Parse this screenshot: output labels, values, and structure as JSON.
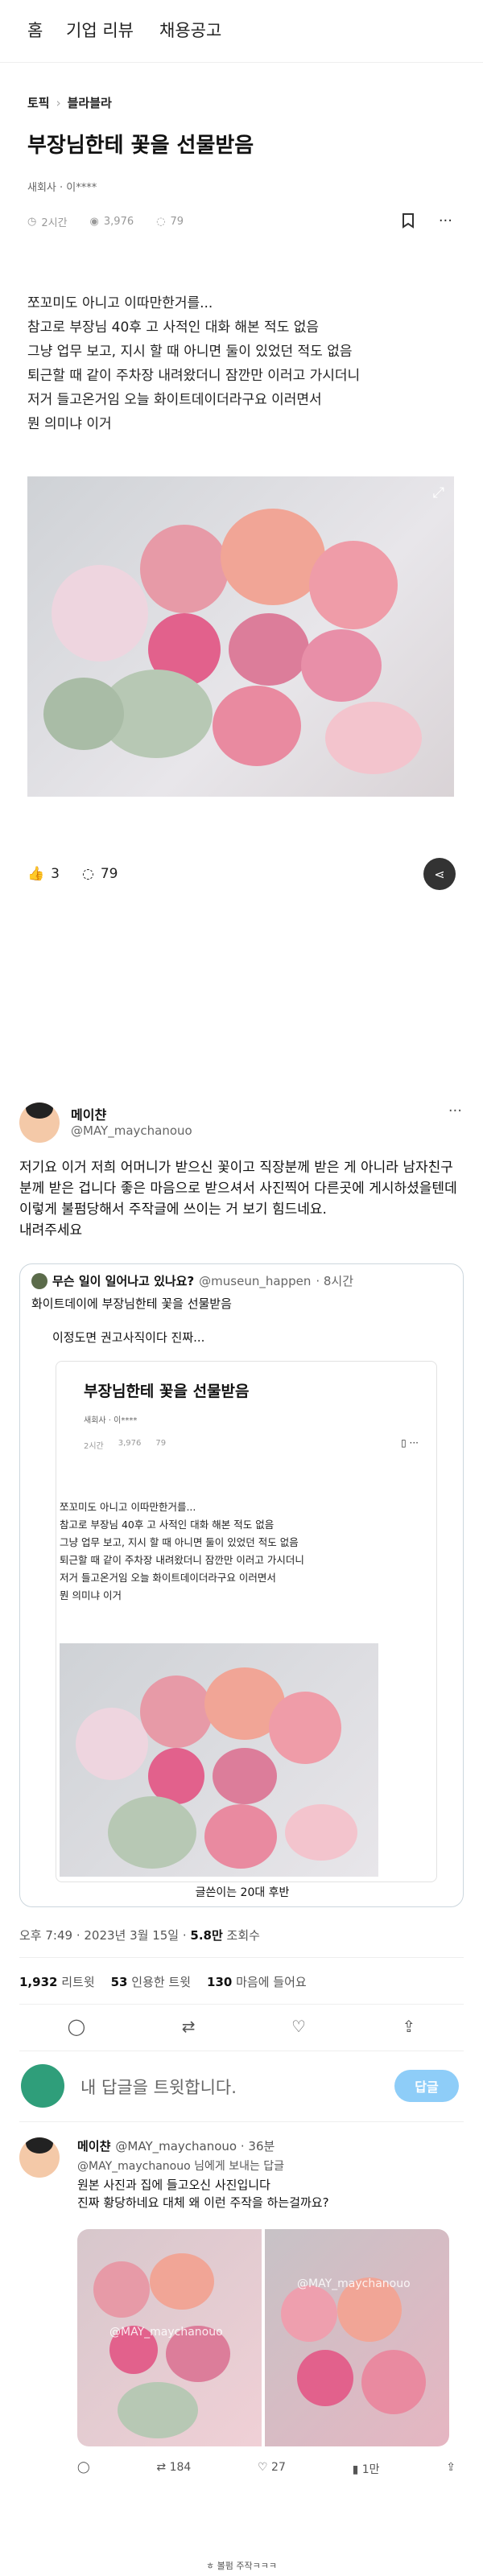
{
  "nav": {
    "items": [
      "홈",
      "기업 리뷰",
      "채용공고"
    ]
  },
  "breadcrumb": {
    "first": "토픽",
    "second": "블라블라"
  },
  "post": {
    "title": "부장님한테 꽃을 선물받음",
    "author": "새회사 · 이****",
    "time": "2시간",
    "views": "3,976",
    "comments": "79",
    "body": "쪼꼬미도 아니고 이따만한거를...\n참고로 부장님 40후 고 사적인 대화 해본 적도 없음\n그냥 업무 보고, 지시 할 때 아니면 둘이 있었던 적도 없음\n퇴근할 때 같이 주차장 내려왔더니 잠깐만 이러고 가시더니\n저거 들고온거임 오늘 화이트데이더라구요 이러면서\n뭔 의미냐 이거",
    "likes": "3",
    "comment_count": "79"
  },
  "tweet": {
    "name": "메이챤",
    "handle": "@MAY_maychanouo",
    "text": "저기요 이거 저희 어머니가 받으신 꽃이고 직장분께 받은 게 아니라 남자친구분께 받은 겁니다 좋은 마음으로 받으셔서 사진찍어 다른곳에 게시하셨을텐데 이렇게 불펌당해서 주작글에 쓰이는 거 보기 힘드네요.\n내려주세요",
    "quote": {
      "title": "무슨 일이 일어나고 있나요?",
      "handle": "@museun_happen",
      "time": "· 8시간",
      "line1": "화이트데이에 부장님한테 꽃을 선물받음",
      "line2": "이정도면 권고사직이다 진짜...",
      "caption": "글쓴이는 20대 후반"
    },
    "timestamp": "오후 7:49 · 2023년 3월 15일 · ",
    "views_num": "5.8만",
    "views_label": " 조회수",
    "retweets_num": "1,932",
    "retweets_label": " 리트윗",
    "quotes_num": "53",
    "quotes_label": " 인용한 트윗",
    "likes_num": "130",
    "likes_label": " 마음에 들어요"
  },
  "reply_box": {
    "placeholder": "내 답글을 트윗합니다.",
    "button": "답글"
  },
  "reply": {
    "name": "메이챤",
    "handle": "@MAY_maychanouo · 36분",
    "reply_to": "@MAY_maychanouo 님에게 보내는 답글",
    "text": "원본 사진과 집에 들고오신 사진입니다\n진짜 황당하네요 대체 왜 이런 주작을 하는걸까요?",
    "watermark1": "@MAY_maychanouo",
    "watermark2": "@MAY_maychanouo",
    "retweets": "184",
    "likes": "27",
    "views": "1만"
  },
  "footer_caption": "ㅎ 볼펌 주작ㅋㅋㅋ",
  "colors": {
    "accent": "#1d9bf0",
    "reply_button": "#8ecdf8"
  }
}
